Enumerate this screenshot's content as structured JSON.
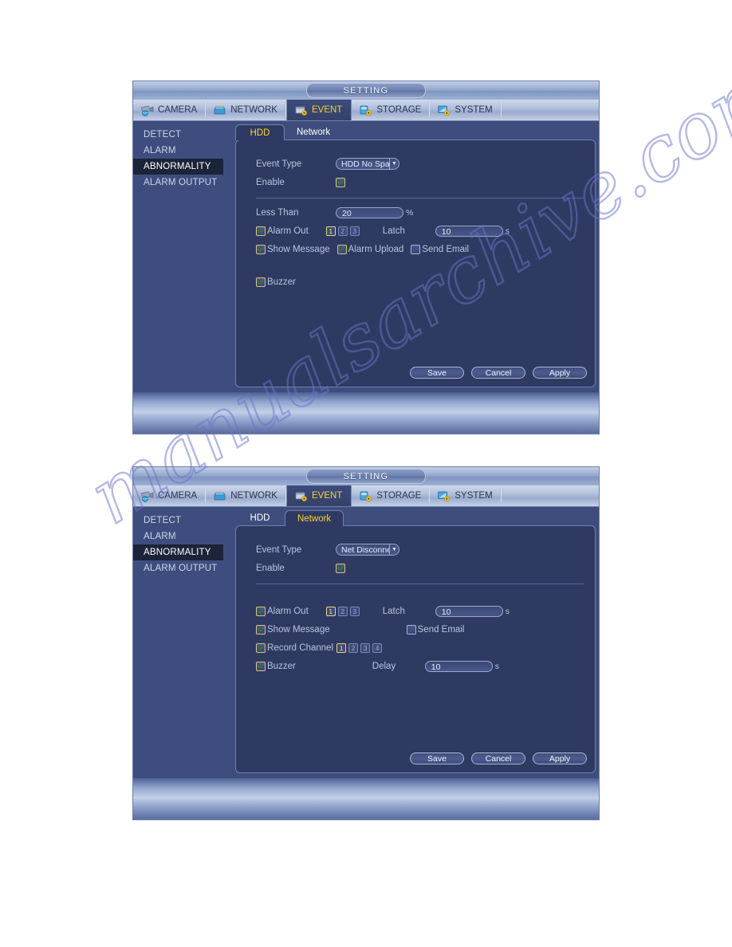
{
  "window": {
    "title": "SETTING",
    "main_tabs": [
      {
        "label": "CAMERA",
        "icon": "camera-icon",
        "active": false
      },
      {
        "label": "NETWORK",
        "icon": "network-icon",
        "active": false
      },
      {
        "label": "EVENT",
        "icon": "event-icon",
        "active": true
      },
      {
        "label": "STORAGE",
        "icon": "storage-icon",
        "active": false
      },
      {
        "label": "SYSTEM",
        "icon": "system-icon",
        "active": false
      }
    ],
    "sidebar": [
      {
        "label": "DETECT",
        "active": false
      },
      {
        "label": "ALARM",
        "active": false
      },
      {
        "label": "ABNORMALITY",
        "active": true
      },
      {
        "label": "ALARM OUTPUT",
        "active": false
      }
    ],
    "buttons": {
      "save": "Save",
      "cancel": "Cancel",
      "apply": "Apply"
    }
  },
  "panel_hdd": {
    "subtabs": [
      {
        "label": "HDD",
        "active": true
      },
      {
        "label": "Network",
        "active": false
      }
    ],
    "event_type_label": "Event Type",
    "event_type_value": "HDD No Spac",
    "enable_label": "Enable",
    "enable_checked": true,
    "less_than_label": "Less Than",
    "less_than_value": "20",
    "less_than_unit": "%",
    "alarm_out_label": "Alarm Out",
    "alarm_out_checked": true,
    "alarm_out_channels": [
      {
        "num": "1",
        "on": true
      },
      {
        "num": "2",
        "on": false
      },
      {
        "num": "3",
        "on": false
      }
    ],
    "latch_label": "Latch",
    "latch_value": "10",
    "latch_unit": "s",
    "show_message_label": "Show Message",
    "show_message_checked": true,
    "alarm_upload_label": "Alarm Upload",
    "alarm_upload_checked": true,
    "send_email_label": "Send Email",
    "send_email_checked": false,
    "buzzer_label": "Buzzer",
    "buzzer_checked": true
  },
  "panel_net": {
    "subtabs": [
      {
        "label": "HDD",
        "active": false
      },
      {
        "label": "Network",
        "active": true
      }
    ],
    "event_type_label": "Event Type",
    "event_type_value": "Net Disconne",
    "enable_label": "Enable",
    "enable_checked": true,
    "alarm_out_label": "Alarm Out",
    "alarm_out_checked": true,
    "alarm_out_channels": [
      {
        "num": "1",
        "on": true
      },
      {
        "num": "2",
        "on": false
      },
      {
        "num": "3",
        "on": false
      }
    ],
    "latch_label": "Latch",
    "latch_value": "10",
    "latch_unit": "s",
    "show_message_label": "Show Message",
    "show_message_checked": true,
    "send_email_label": "Send Email",
    "send_email_checked": false,
    "record_channel_label": "Record Channel",
    "record_channel_checked": true,
    "record_channels": [
      {
        "num": "1",
        "on": true
      },
      {
        "num": "2",
        "on": false
      },
      {
        "num": "3",
        "on": false
      },
      {
        "num": "4",
        "on": false
      }
    ],
    "buzzer_label": "Buzzer",
    "buzzer_checked": true,
    "delay_label": "Delay",
    "delay_value": "10",
    "delay_unit": "s"
  },
  "watermark": {
    "text": "manualsarchive.com",
    "color": "#6b74c8"
  }
}
